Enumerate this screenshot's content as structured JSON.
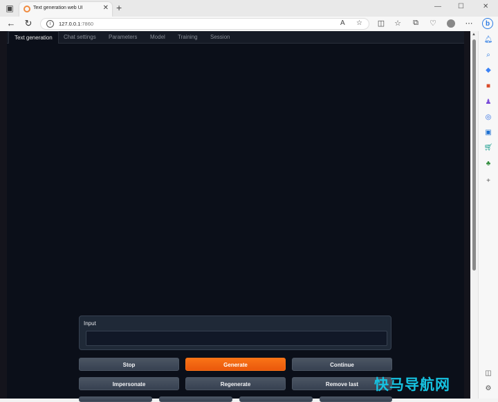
{
  "browser": {
    "tab_title": "Text generation web UI",
    "url_host": "127.0.0.1",
    "url_port": ":7860"
  },
  "app": {
    "tabs": [
      {
        "label": "Text generation",
        "active": true
      },
      {
        "label": "Chat settings",
        "active": false
      },
      {
        "label": "Parameters",
        "active": false
      },
      {
        "label": "Model",
        "active": false
      },
      {
        "label": "Training",
        "active": false
      },
      {
        "label": "Session",
        "active": false
      }
    ],
    "input": {
      "label": "Input",
      "value": ""
    },
    "buttons": {
      "stop": "Stop",
      "generate": "Generate",
      "continue": "Continue",
      "impersonate": "Impersonate",
      "regenerate": "Regenerate",
      "remove_last": "Remove last"
    }
  },
  "watermark": "快马导航网",
  "colors": {
    "page_bg": "#0b0f19",
    "primary_button": "#f97316",
    "secondary_button": "#4b5563",
    "watermark": "#16c2e0"
  },
  "icons": [
    "tab-actions-icon",
    "favicon-icon",
    "close-tab-icon",
    "new-tab-icon",
    "back-icon",
    "refresh-icon",
    "info-icon",
    "read-aloud-icon",
    "favorite-icon",
    "split-screen-icon",
    "favorites-icon",
    "collections-icon",
    "browser-essentials-icon",
    "profile-icon",
    "more-icon",
    "bing-icon"
  ]
}
